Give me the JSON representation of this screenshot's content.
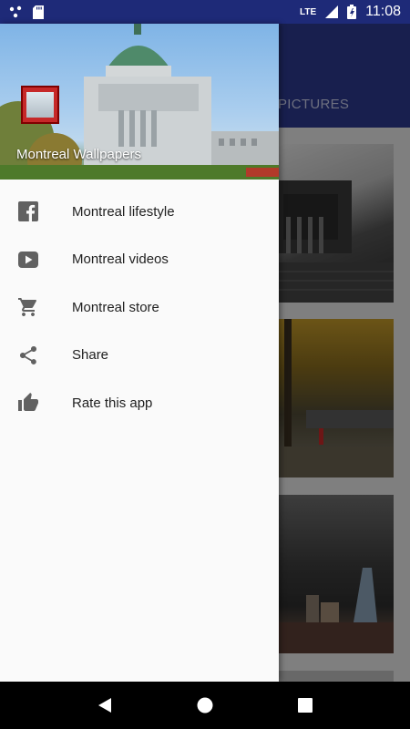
{
  "status_bar": {
    "time": "11:08",
    "network": "LTE"
  },
  "app": {
    "tab_label": "PICTURES"
  },
  "drawer": {
    "title": "Montreal Wallpapers",
    "items": [
      {
        "label": "Montreal lifestyle",
        "icon": "facebook-icon"
      },
      {
        "label": "Montreal videos",
        "icon": "youtube-icon"
      },
      {
        "label": "Montreal store",
        "icon": "cart-icon"
      },
      {
        "label": "Share",
        "icon": "share-icon"
      },
      {
        "label": "Rate this app",
        "icon": "thumbs-up-icon"
      }
    ]
  },
  "colors": {
    "status_bar": "#1e2a78",
    "app_bar": "#2c3a8f",
    "drawer_bg": "#fafafa",
    "icon_gray": "#616161"
  }
}
